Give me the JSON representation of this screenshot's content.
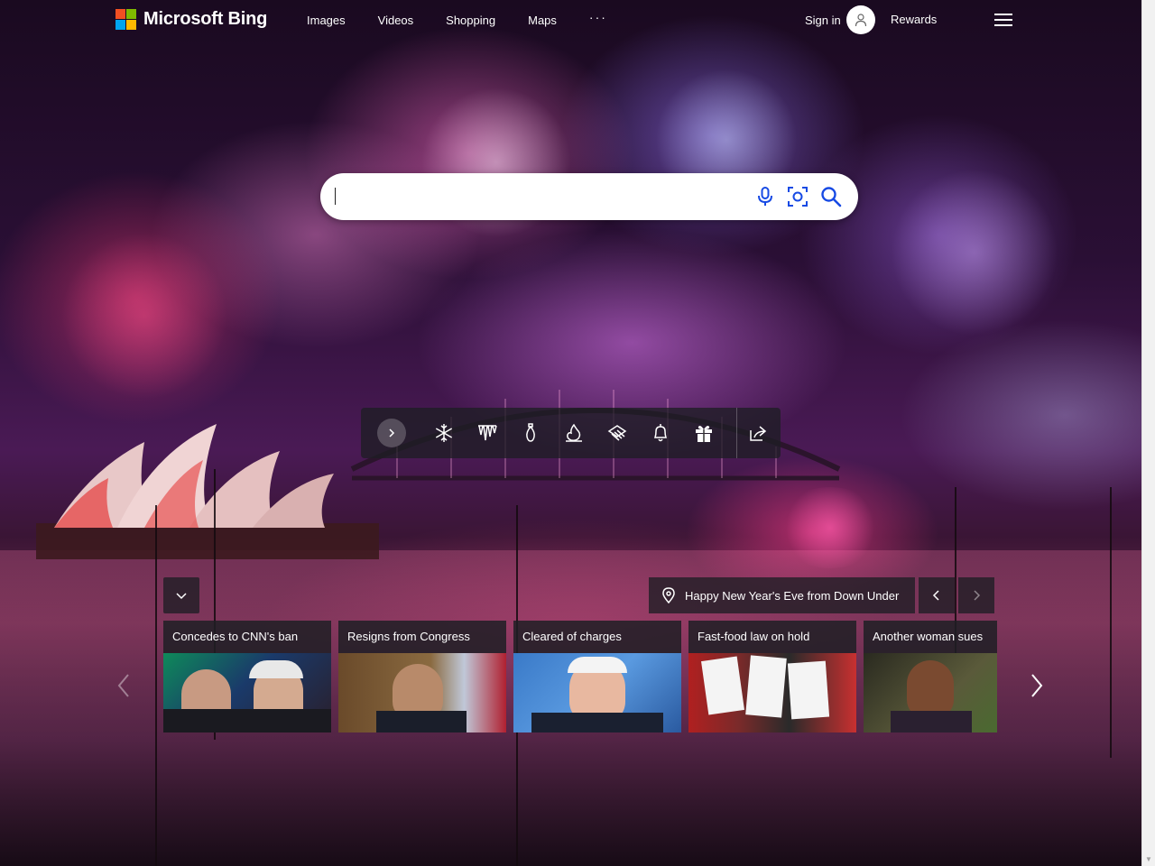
{
  "header": {
    "brand": "Microsoft Bing",
    "nav": [
      "Images",
      "Videos",
      "Shopping",
      "Maps",
      "···"
    ],
    "sign_in": "Sign in",
    "rewards": "Rewards"
  },
  "search": {
    "value": "",
    "icons": [
      "microphone-icon",
      "visual-search-icon",
      "search-icon"
    ]
  },
  "toolbar": {
    "icons": [
      "chevron-right-icon",
      "snowflake-icon",
      "icicles-icon",
      "lightbulb-icon",
      "fire-icon",
      "scarf-icon",
      "bell-icon",
      "gift-icon",
      "share-icon"
    ]
  },
  "image_info": {
    "title": "Happy New Year's Eve from Down Under"
  },
  "news": [
    {
      "title": "Concedes to CNN's ban"
    },
    {
      "title": "Resigns from Congress"
    },
    {
      "title": "Cleared of charges"
    },
    {
      "title": "Fast-food law on hold"
    },
    {
      "title": "Another woman sues"
    }
  ],
  "colors": {
    "ms_red": "#f25022",
    "ms_green": "#7fba00",
    "ms_blue": "#00a4ef",
    "ms_yellow": "#ffb900",
    "search_icon_blue": "#174ae4"
  }
}
